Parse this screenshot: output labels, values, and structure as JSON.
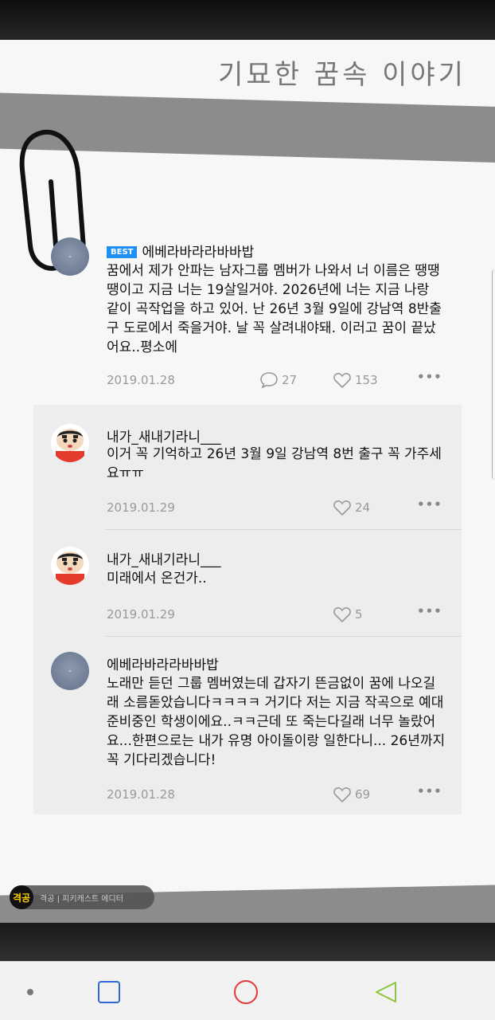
{
  "header": {
    "title": "기묘한 꿈속 이야기"
  },
  "comments": [
    {
      "badge": "BEST",
      "author": "에베라바라라바바밥",
      "text": "꿈에서 제가 안파는 남자그룹 멤버가 나와서 너 이름은 땡땡땡이고 지금 너는 19살일거야. 2026년에 너는 지금 나랑 같이 곡작업을 하고 있어. 난 26년 3월 9일에 강남역 8반출구 도로에서 죽을거야. 날 꼭 살려내야돼. 이러고 꿈이 끝났어요..평소에",
      "date": "2019.01.28",
      "replies": "27",
      "likes": "153",
      "avatar": "blue-avatar"
    },
    {
      "author": "내가_새내기라니___",
      "text": "이거 꼭 기억하고 26년 3월 9일 강남역 8번 출구 꼭 가주세요ㅠㅠ",
      "date": "2019.01.29",
      "likes": "24",
      "avatar": "shinchan-avatar"
    },
    {
      "author": "내가_새내기라니___",
      "text": "미래에서 온건가..",
      "date": "2019.01.29",
      "likes": "5",
      "avatar": "shinchan-avatar"
    },
    {
      "author": "에베라바라라바바밥",
      "text": "노래만 듣던 그룹 멤버였는데 갑자기 뜬금없이 꿈에 나오길래 소름돋았습니다ㅋㅋㅋㅋ 거기다 저는 지금 작곡으로 예대 준비중인 학생이에요..ㅋㅋ근데 또 죽는다길래 너무 놀랐어요...한편으로는 내가 유명 아이돌이랑 일한다니... 26년까지 꼭 기다리겠습니다!",
      "date": "2019.01.28",
      "likes": "69",
      "avatar": "blue-avatar"
    }
  ],
  "more_label": "•••",
  "watermark": {
    "logo": "격공",
    "text": "격공 | 피키캐스트 에디터"
  },
  "navbar": {
    "items": [
      "dot",
      "recent-apps",
      "home",
      "back"
    ]
  },
  "colors": {
    "best_badge": "#1e8ff5",
    "home_circle": "#e03a3a",
    "recent_square": "#2f6ad8",
    "back_triangle": "#8cc63f"
  }
}
